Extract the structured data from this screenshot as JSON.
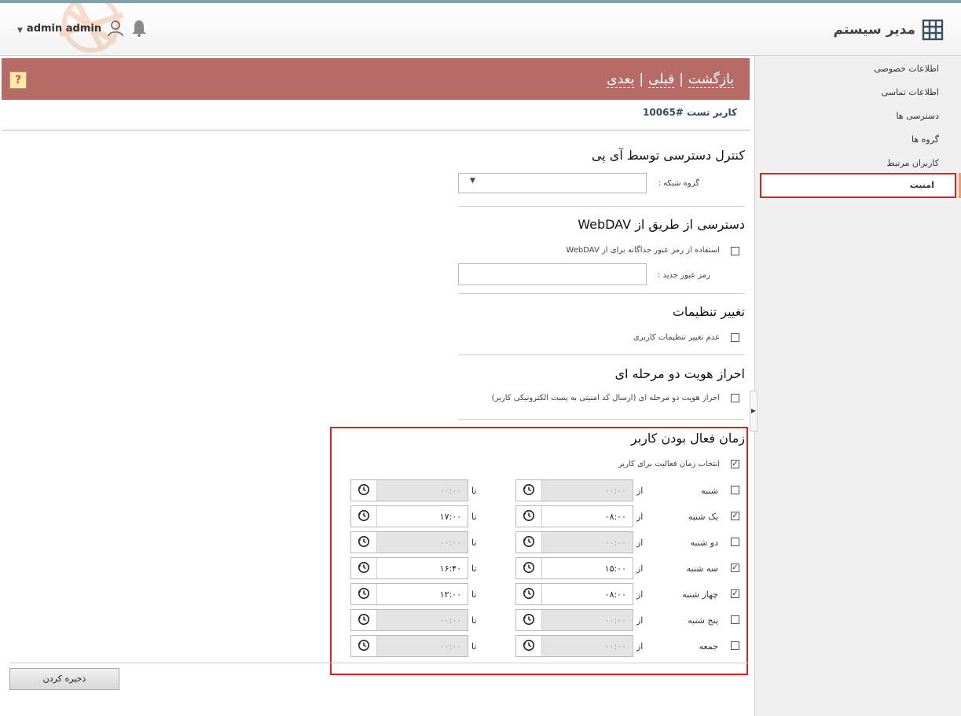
{
  "header": {
    "brand": "مدیر سیستم",
    "user_name": "admin admin"
  },
  "sidebar": {
    "items": [
      {
        "label": "اطلاعات خصوصی",
        "active": false
      },
      {
        "label": "اطلاعات تماسی",
        "active": false
      },
      {
        "label": "دسترسی ها",
        "active": false
      },
      {
        "label": "گروه ها",
        "active": false
      },
      {
        "label": "کاربران مرتبط",
        "active": false
      },
      {
        "label": "امنیت",
        "active": true
      }
    ]
  },
  "banner": {
    "back": "بازگشت",
    "prev": "قبلی",
    "next": "بعدی",
    "separator": "|",
    "help": "?"
  },
  "user_title": "کاربر تست #10065",
  "ip_section": {
    "title": "کنترل دسترسی توسط آی پی",
    "network_group_label": "گروه شبکه :",
    "network_group_value": ""
  },
  "webdav_section": {
    "title": "دسترسی از طریق از WebDAV",
    "separate_password_label": "استفاده از رمز عبور جداگانه برای از WebDAV",
    "separate_password_checked": false,
    "new_password_label": "رمز عبور جدید :",
    "new_password_value": ""
  },
  "settings_section": {
    "title": "تغییر تنظیمات",
    "no_change_label": "عدم تغییر تنظیمات کاربری",
    "no_change_checked": false
  },
  "twofa_section": {
    "title": "احراز هویت دو مرحله ای",
    "twofa_label": "احراز هویت دو مرحله ای (ارسال کد امنیتی به پست الکترونیکی کاربر)",
    "twofa_checked": false
  },
  "schedule_section": {
    "title": "زمان فعال بودن کاربر",
    "enable_label": "انتخاب زمان فعالیت برای کاربر",
    "enable_checked": true,
    "from_label": "از",
    "to_label": "تا",
    "days": [
      {
        "name": "شنبه",
        "checked": false,
        "from": "۰۰:۰۰",
        "to": "۰۰:۰۰"
      },
      {
        "name": "یک شنبه",
        "checked": true,
        "from": "۰۸:۰۰",
        "to": "۱۷:۰۰"
      },
      {
        "name": "دو شنبه",
        "checked": false,
        "from": "۰۰:۰۰",
        "to": "۰۰:۰۰"
      },
      {
        "name": "سه شنبه",
        "checked": true,
        "from": "۱۵:۰۰",
        "to": "۱۶:۴۰"
      },
      {
        "name": "چهار شنبه",
        "checked": true,
        "from": "۰۸:۰۰",
        "to": "۱۲:۰۰"
      },
      {
        "name": "پنج شنبه",
        "checked": false,
        "from": "۰۰:۰۰",
        "to": "۰۰:۰۰"
      },
      {
        "name": "جمعه",
        "checked": false,
        "from": "۰۰:۰۰",
        "to": "۰۰:۰۰"
      }
    ]
  },
  "save_label": "ذخیره کردن",
  "check_mark": "✓"
}
